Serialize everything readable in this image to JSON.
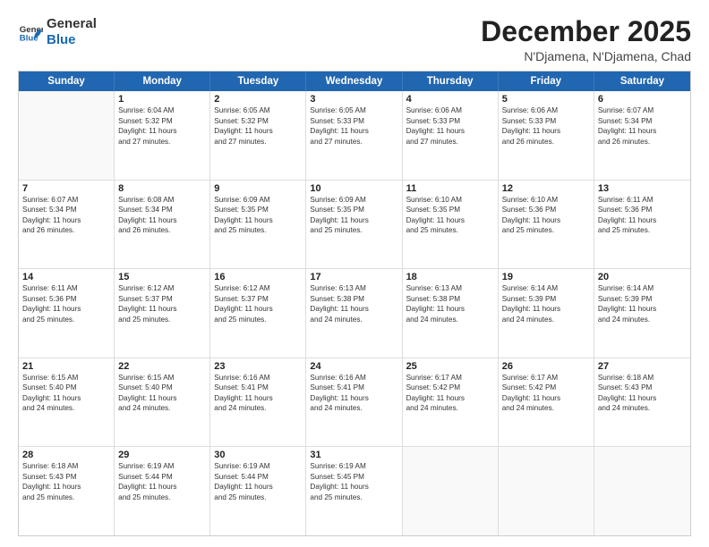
{
  "header": {
    "logo_general": "General",
    "logo_blue": "Blue",
    "title": "December 2025",
    "location": "N'Djamena, N'Djamena, Chad"
  },
  "days_of_week": [
    "Sunday",
    "Monday",
    "Tuesday",
    "Wednesday",
    "Thursday",
    "Friday",
    "Saturday"
  ],
  "weeks": [
    [
      {
        "day": "",
        "empty": true
      },
      {
        "day": "1",
        "sunrise": "6:04 AM",
        "sunset": "5:32 PM",
        "daylight": "11 hours and 27 minutes."
      },
      {
        "day": "2",
        "sunrise": "6:05 AM",
        "sunset": "5:32 PM",
        "daylight": "11 hours and 27 minutes."
      },
      {
        "day": "3",
        "sunrise": "6:05 AM",
        "sunset": "5:33 PM",
        "daylight": "11 hours and 27 minutes."
      },
      {
        "day": "4",
        "sunrise": "6:06 AM",
        "sunset": "5:33 PM",
        "daylight": "11 hours and 27 minutes."
      },
      {
        "day": "5",
        "sunrise": "6:06 AM",
        "sunset": "5:33 PM",
        "daylight": "11 hours and 26 minutes."
      },
      {
        "day": "6",
        "sunrise": "6:07 AM",
        "sunset": "5:34 PM",
        "daylight": "11 hours and 26 minutes."
      }
    ],
    [
      {
        "day": "7",
        "sunrise": "6:07 AM",
        "sunset": "5:34 PM",
        "daylight": "11 hours and 26 minutes."
      },
      {
        "day": "8",
        "sunrise": "6:08 AM",
        "sunset": "5:34 PM",
        "daylight": "11 hours and 26 minutes."
      },
      {
        "day": "9",
        "sunrise": "6:09 AM",
        "sunset": "5:35 PM",
        "daylight": "11 hours and 25 minutes."
      },
      {
        "day": "10",
        "sunrise": "6:09 AM",
        "sunset": "5:35 PM",
        "daylight": "11 hours and 25 minutes."
      },
      {
        "day": "11",
        "sunrise": "6:10 AM",
        "sunset": "5:35 PM",
        "daylight": "11 hours and 25 minutes."
      },
      {
        "day": "12",
        "sunrise": "6:10 AM",
        "sunset": "5:36 PM",
        "daylight": "11 hours and 25 minutes."
      },
      {
        "day": "13",
        "sunrise": "6:11 AM",
        "sunset": "5:36 PM",
        "daylight": "11 hours and 25 minutes."
      }
    ],
    [
      {
        "day": "14",
        "sunrise": "6:11 AM",
        "sunset": "5:36 PM",
        "daylight": "11 hours and 25 minutes."
      },
      {
        "day": "15",
        "sunrise": "6:12 AM",
        "sunset": "5:37 PM",
        "daylight": "11 hours and 25 minutes."
      },
      {
        "day": "16",
        "sunrise": "6:12 AM",
        "sunset": "5:37 PM",
        "daylight": "11 hours and 25 minutes."
      },
      {
        "day": "17",
        "sunrise": "6:13 AM",
        "sunset": "5:38 PM",
        "daylight": "11 hours and 24 minutes."
      },
      {
        "day": "18",
        "sunrise": "6:13 AM",
        "sunset": "5:38 PM",
        "daylight": "11 hours and 24 minutes."
      },
      {
        "day": "19",
        "sunrise": "6:14 AM",
        "sunset": "5:39 PM",
        "daylight": "11 hours and 24 minutes."
      },
      {
        "day": "20",
        "sunrise": "6:14 AM",
        "sunset": "5:39 PM",
        "daylight": "11 hours and 24 minutes."
      }
    ],
    [
      {
        "day": "21",
        "sunrise": "6:15 AM",
        "sunset": "5:40 PM",
        "daylight": "11 hours and 24 minutes."
      },
      {
        "day": "22",
        "sunrise": "6:15 AM",
        "sunset": "5:40 PM",
        "daylight": "11 hours and 24 minutes."
      },
      {
        "day": "23",
        "sunrise": "6:16 AM",
        "sunset": "5:41 PM",
        "daylight": "11 hours and 24 minutes."
      },
      {
        "day": "24",
        "sunrise": "6:16 AM",
        "sunset": "5:41 PM",
        "daylight": "11 hours and 24 minutes."
      },
      {
        "day": "25",
        "sunrise": "6:17 AM",
        "sunset": "5:42 PM",
        "daylight": "11 hours and 24 minutes."
      },
      {
        "day": "26",
        "sunrise": "6:17 AM",
        "sunset": "5:42 PM",
        "daylight": "11 hours and 24 minutes."
      },
      {
        "day": "27",
        "sunrise": "6:18 AM",
        "sunset": "5:43 PM",
        "daylight": "11 hours and 24 minutes."
      }
    ],
    [
      {
        "day": "28",
        "sunrise": "6:18 AM",
        "sunset": "5:43 PM",
        "daylight": "11 hours and 25 minutes."
      },
      {
        "day": "29",
        "sunrise": "6:19 AM",
        "sunset": "5:44 PM",
        "daylight": "11 hours and 25 minutes."
      },
      {
        "day": "30",
        "sunrise": "6:19 AM",
        "sunset": "5:44 PM",
        "daylight": "11 hours and 25 minutes."
      },
      {
        "day": "31",
        "sunrise": "6:19 AM",
        "sunset": "5:45 PM",
        "daylight": "11 hours and 25 minutes."
      },
      {
        "day": "",
        "empty": true
      },
      {
        "day": "",
        "empty": true
      },
      {
        "day": "",
        "empty": true
      }
    ]
  ]
}
